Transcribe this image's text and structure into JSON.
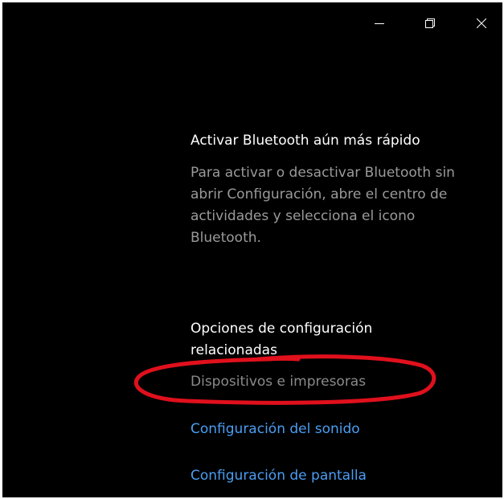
{
  "window": {
    "background": "#000000",
    "caption_buttons": [
      {
        "name": "minimize",
        "icon": "minimize-icon"
      },
      {
        "name": "maximize",
        "icon": "restore-icon"
      },
      {
        "name": "close",
        "icon": "close-icon"
      }
    ]
  },
  "tip": {
    "title": "Activar Bluetooth aún más rápido",
    "body": "Para activar o desactivar Bluetooth sin abrir Configuración, abre el centro de actividades y selecciona el icono Bluetooth."
  },
  "related": {
    "title": "Opciones de configuración relacionadas",
    "links": [
      {
        "label": "Dispositivos e impresoras",
        "color": "#8a8a8a"
      },
      {
        "label": "Configuración del sonido",
        "color": "#4a9ef2"
      },
      {
        "label": "Configuración de pantalla",
        "color": "#4a9ef2"
      }
    ]
  },
  "annotation": {
    "color": "#e0101c",
    "shape": "hand-drawn-ellipse"
  }
}
